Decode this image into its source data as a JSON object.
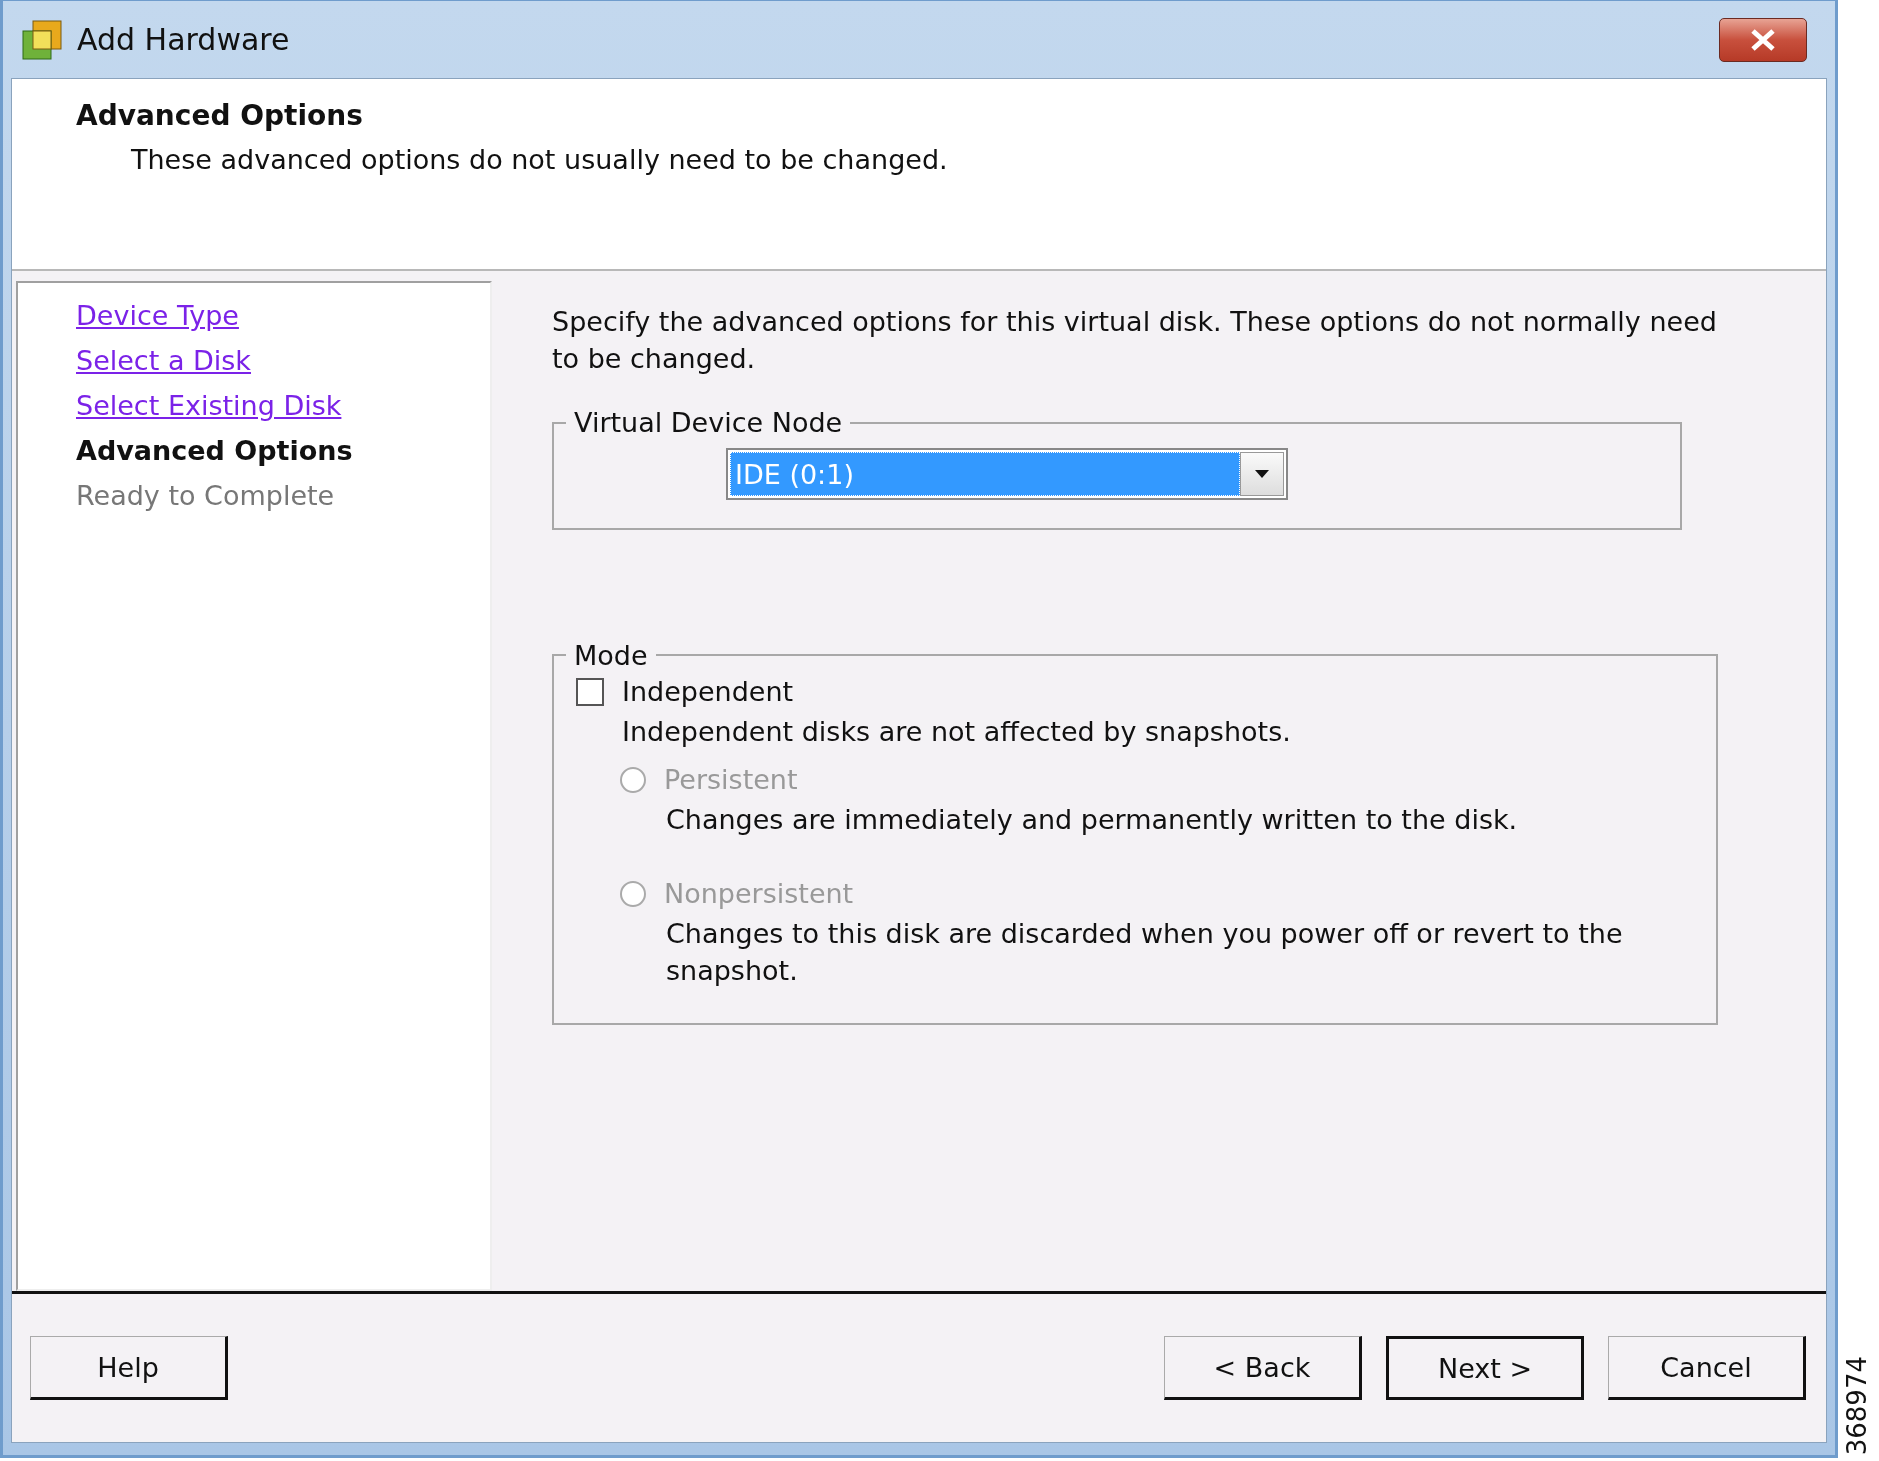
{
  "window": {
    "title": "Add Hardware"
  },
  "header": {
    "title": "Advanced Options",
    "subtitle": "These advanced options do not usually need to be changed."
  },
  "steps": [
    {
      "label": "Device Type",
      "kind": "link"
    },
    {
      "label": "Select a Disk",
      "kind": "link"
    },
    {
      "label": "Select Existing Disk",
      "kind": "link"
    },
    {
      "label": "Advanced Options",
      "kind": "current"
    },
    {
      "label": "Ready to Complete",
      "kind": "pending"
    }
  ],
  "intro": "Specify the advanced options for this virtual disk. These options do not normally need to be changed.",
  "virtual_device_node": {
    "legend": "Virtual Device Node",
    "select": {
      "value": "IDE (0:1)"
    }
  },
  "mode": {
    "legend": "Mode",
    "independent": {
      "label": "Independent",
      "checked": false,
      "description": "Independent disks are not affected by snapshots."
    },
    "options": [
      {
        "label": "Persistent",
        "selected": false,
        "disabled": true,
        "description": "Changes are immediately and permanently written to the disk."
      },
      {
        "label": "Nonpersistent",
        "selected": false,
        "disabled": true,
        "description": "Changes to this disk are discarded when you power off or revert to the snapshot."
      }
    ]
  },
  "buttons": [
    {
      "label": "Help",
      "default": false
    },
    {
      "label": "< Back",
      "default": false
    },
    {
      "label": "Next >",
      "default": true
    },
    {
      "label": "Cancel",
      "default": false
    }
  ],
  "figure_id": "368974"
}
